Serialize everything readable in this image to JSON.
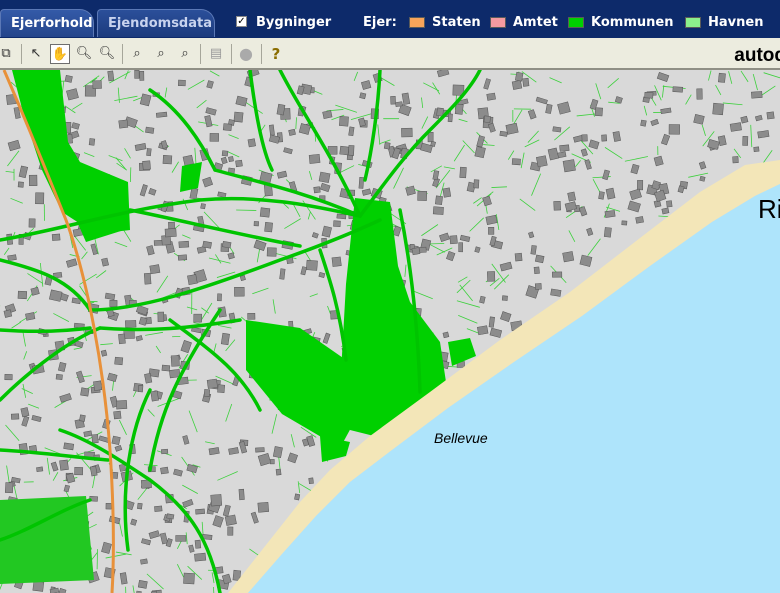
{
  "tabs": [
    {
      "label": "Ejerforhold",
      "active": true
    },
    {
      "label": "Ejendomsdata",
      "active": false
    }
  ],
  "layer_toggle": {
    "label": "Bygninger",
    "checked": true
  },
  "owner_legend": {
    "label": "Ejer:",
    "items": [
      {
        "label": "Staten",
        "color": "#f7a45a"
      },
      {
        "label": "Amtet",
        "color": "#f59aa0"
      },
      {
        "label": "Kommunen",
        "color": "#00d000"
      },
      {
        "label": "Havnen",
        "color": "#8cf08c"
      }
    ]
  },
  "toolbar": {
    "tools": [
      "copy-icon",
      "pointer-icon",
      "pan-hand-icon",
      "zoom-in-icon",
      "zoom-out-icon",
      "zoom-in-box-icon",
      "zoom-out-box-icon",
      "zoom-clear-icon",
      "print-icon",
      "stop-icon",
      "help-icon"
    ],
    "selected_tool": "pan-hand-icon",
    "brand": "autod"
  },
  "map": {
    "labels": [
      {
        "text": "Bellevue"
      },
      {
        "text": "Ri"
      }
    ],
    "colors": {
      "sea": "#aee4fb",
      "beach": "#f3e6b8",
      "land": "#d9d9d9",
      "municipal": "#00d000",
      "road_orange": "#e8913a",
      "building": "#8c8c8c",
      "property_line": "#3cd03c"
    }
  }
}
